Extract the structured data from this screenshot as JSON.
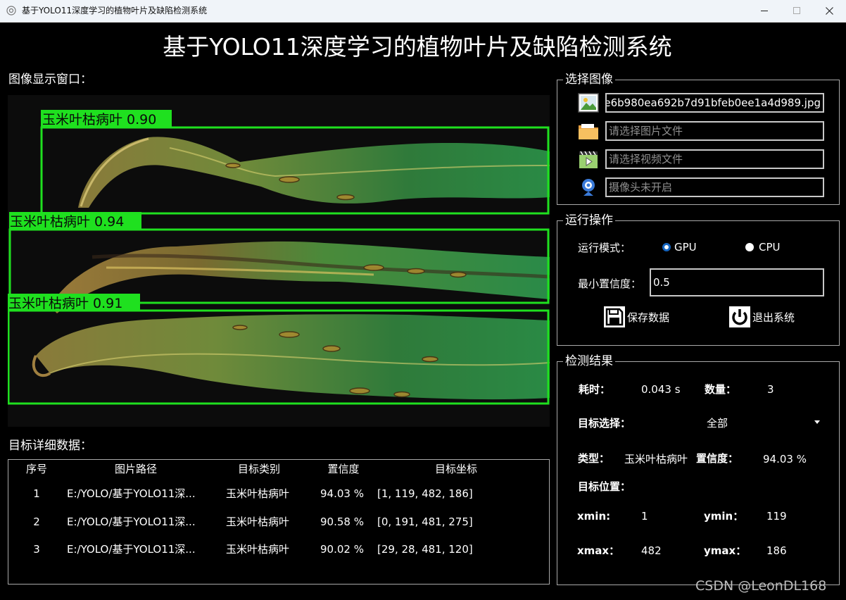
{
  "window": {
    "title": "基于YOLO11深度学习的植物叶片及缺陷检测系统"
  },
  "header": {
    "title": "基于YOLO11深度学习的植物叶片及缺陷检测系统"
  },
  "image_panel": {
    "label": "图像显示窗口：",
    "detections": [
      {
        "label": "玉米叶枯病叶 0.90"
      },
      {
        "label": "玉米叶枯病叶 0.94"
      },
      {
        "label": "玉米叶枯病叶 0.91"
      }
    ],
    "box_color": "#1fe01f"
  },
  "select_image": {
    "title": "选择图像",
    "image_file": "2e6b980ea692b7d91bfeb0ee1a4d989.jpg",
    "folder_placeholder": "请选择图片文件",
    "video_placeholder": "请选择视频文件",
    "camera_placeholder": "摄像头未开启"
  },
  "run_ops": {
    "title": "运行操作",
    "mode_label": "运行模式：",
    "gpu_label": "GPU",
    "cpu_label": "CPU",
    "mode_selected": "GPU",
    "conf_label": "最小置信度：",
    "conf_value": "0.5",
    "save_label": "保存数据",
    "exit_label": "退出系统"
  },
  "result": {
    "title": "检测结果",
    "time_label": "耗时：",
    "time_value": "0.043 s",
    "count_label": "数量：",
    "count_value": "3",
    "target_label": "目标选择：",
    "target_value": "全部",
    "type_label": "类型：",
    "type_value": "玉米叶枯病叶",
    "conf_label": "置信度：",
    "conf_value": "94.03 %",
    "position_label": "目标位置：",
    "xmin_label": "xmin:",
    "xmin_value": "1",
    "ymin_label": "ymin：",
    "ymin_value": "119",
    "xmax_label": "xmax：",
    "xmax_value": "482",
    "ymax_label": "ymax：",
    "ymax_value": "186"
  },
  "table": {
    "label": "目标详细数据：",
    "headers": [
      "序号",
      "图片路径",
      "目标类别",
      "置信度",
      "目标坐标"
    ],
    "rows": [
      [
        "1",
        "E:/YOLO/基于YOLO11深...",
        "玉米叶枯病叶",
        "94.03 %",
        "[1, 119, 482, 186]"
      ],
      [
        "2",
        "E:/YOLO/基于YOLO11深...",
        "玉米叶枯病叶",
        "90.58 %",
        "[0, 191, 481, 275]"
      ],
      [
        "3",
        "E:/YOLO/基于YOLO11深...",
        "玉米叶枯病叶",
        "90.02 %",
        "[29, 28, 481, 120]"
      ]
    ]
  },
  "watermark": "CSDN @LeonDL168"
}
